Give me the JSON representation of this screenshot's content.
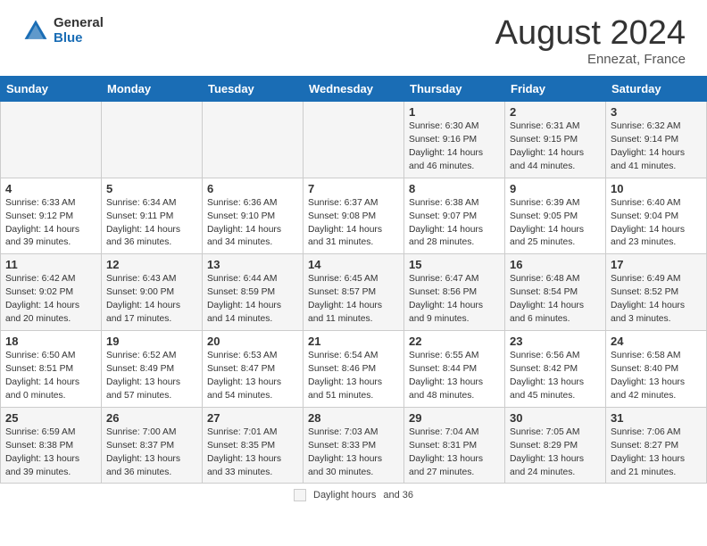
{
  "header": {
    "logo_general": "General",
    "logo_blue": "Blue",
    "month_title": "August 2024",
    "subtitle": "Ennezat, France"
  },
  "calendar": {
    "days_of_week": [
      "Sunday",
      "Monday",
      "Tuesday",
      "Wednesday",
      "Thursday",
      "Friday",
      "Saturday"
    ],
    "weeks": [
      [
        {
          "day": "",
          "info": ""
        },
        {
          "day": "",
          "info": ""
        },
        {
          "day": "",
          "info": ""
        },
        {
          "day": "",
          "info": ""
        },
        {
          "day": "1",
          "info": "Sunrise: 6:30 AM\nSunset: 9:16 PM\nDaylight: 14 hours\nand 46 minutes."
        },
        {
          "day": "2",
          "info": "Sunrise: 6:31 AM\nSunset: 9:15 PM\nDaylight: 14 hours\nand 44 minutes."
        },
        {
          "day": "3",
          "info": "Sunrise: 6:32 AM\nSunset: 9:14 PM\nDaylight: 14 hours\nand 41 minutes."
        }
      ],
      [
        {
          "day": "4",
          "info": "Sunrise: 6:33 AM\nSunset: 9:12 PM\nDaylight: 14 hours\nand 39 minutes."
        },
        {
          "day": "5",
          "info": "Sunrise: 6:34 AM\nSunset: 9:11 PM\nDaylight: 14 hours\nand 36 minutes."
        },
        {
          "day": "6",
          "info": "Sunrise: 6:36 AM\nSunset: 9:10 PM\nDaylight: 14 hours\nand 34 minutes."
        },
        {
          "day": "7",
          "info": "Sunrise: 6:37 AM\nSunset: 9:08 PM\nDaylight: 14 hours\nand 31 minutes."
        },
        {
          "day": "8",
          "info": "Sunrise: 6:38 AM\nSunset: 9:07 PM\nDaylight: 14 hours\nand 28 minutes."
        },
        {
          "day": "9",
          "info": "Sunrise: 6:39 AM\nSunset: 9:05 PM\nDaylight: 14 hours\nand 25 minutes."
        },
        {
          "day": "10",
          "info": "Sunrise: 6:40 AM\nSunset: 9:04 PM\nDaylight: 14 hours\nand 23 minutes."
        }
      ],
      [
        {
          "day": "11",
          "info": "Sunrise: 6:42 AM\nSunset: 9:02 PM\nDaylight: 14 hours\nand 20 minutes."
        },
        {
          "day": "12",
          "info": "Sunrise: 6:43 AM\nSunset: 9:00 PM\nDaylight: 14 hours\nand 17 minutes."
        },
        {
          "day": "13",
          "info": "Sunrise: 6:44 AM\nSunset: 8:59 PM\nDaylight: 14 hours\nand 14 minutes."
        },
        {
          "day": "14",
          "info": "Sunrise: 6:45 AM\nSunset: 8:57 PM\nDaylight: 14 hours\nand 11 minutes."
        },
        {
          "day": "15",
          "info": "Sunrise: 6:47 AM\nSunset: 8:56 PM\nDaylight: 14 hours\nand 9 minutes."
        },
        {
          "day": "16",
          "info": "Sunrise: 6:48 AM\nSunset: 8:54 PM\nDaylight: 14 hours\nand 6 minutes."
        },
        {
          "day": "17",
          "info": "Sunrise: 6:49 AM\nSunset: 8:52 PM\nDaylight: 14 hours\nand 3 minutes."
        }
      ],
      [
        {
          "day": "18",
          "info": "Sunrise: 6:50 AM\nSunset: 8:51 PM\nDaylight: 14 hours\nand 0 minutes."
        },
        {
          "day": "19",
          "info": "Sunrise: 6:52 AM\nSunset: 8:49 PM\nDaylight: 13 hours\nand 57 minutes."
        },
        {
          "day": "20",
          "info": "Sunrise: 6:53 AM\nSunset: 8:47 PM\nDaylight: 13 hours\nand 54 minutes."
        },
        {
          "day": "21",
          "info": "Sunrise: 6:54 AM\nSunset: 8:46 PM\nDaylight: 13 hours\nand 51 minutes."
        },
        {
          "day": "22",
          "info": "Sunrise: 6:55 AM\nSunset: 8:44 PM\nDaylight: 13 hours\nand 48 minutes."
        },
        {
          "day": "23",
          "info": "Sunrise: 6:56 AM\nSunset: 8:42 PM\nDaylight: 13 hours\nand 45 minutes."
        },
        {
          "day": "24",
          "info": "Sunrise: 6:58 AM\nSunset: 8:40 PM\nDaylight: 13 hours\nand 42 minutes."
        }
      ],
      [
        {
          "day": "25",
          "info": "Sunrise: 6:59 AM\nSunset: 8:38 PM\nDaylight: 13 hours\nand 39 minutes."
        },
        {
          "day": "26",
          "info": "Sunrise: 7:00 AM\nSunset: 8:37 PM\nDaylight: 13 hours\nand 36 minutes."
        },
        {
          "day": "27",
          "info": "Sunrise: 7:01 AM\nSunset: 8:35 PM\nDaylight: 13 hours\nand 33 minutes."
        },
        {
          "day": "28",
          "info": "Sunrise: 7:03 AM\nSunset: 8:33 PM\nDaylight: 13 hours\nand 30 minutes."
        },
        {
          "day": "29",
          "info": "Sunrise: 7:04 AM\nSunset: 8:31 PM\nDaylight: 13 hours\nand 27 minutes."
        },
        {
          "day": "30",
          "info": "Sunrise: 7:05 AM\nSunset: 8:29 PM\nDaylight: 13 hours\nand 24 minutes."
        },
        {
          "day": "31",
          "info": "Sunrise: 7:06 AM\nSunset: 8:27 PM\nDaylight: 13 hours\nand 21 minutes."
        }
      ]
    ]
  },
  "footer": {
    "daylight_label": "Daylight hours",
    "legend_text": "and 36"
  }
}
